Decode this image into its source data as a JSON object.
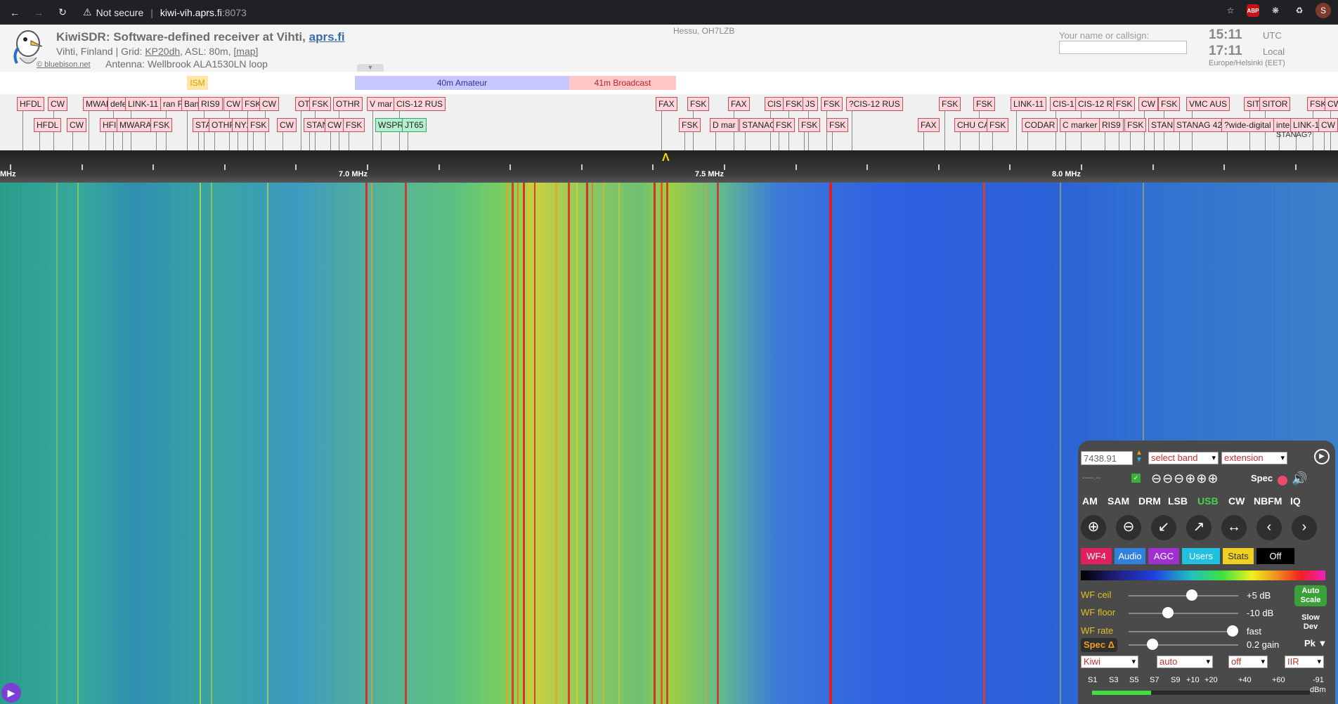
{
  "browser": {
    "security_text": "Not secure",
    "host": "kiwi-vih.aprs.fi",
    "port": ":8073",
    "avatar_letter": "S",
    "abp_label": "ABP"
  },
  "header": {
    "title_prefix": "KiwiSDR: Software-defined receiver at Vihti,",
    "title_link": "aprs.fi",
    "location_prefix": "Vihti, Finland | Grid:",
    "grid": "KP20dh",
    "asl": ", ASL: 80m,",
    "map_link": "[map]",
    "logo_credit": "© bluebison.net",
    "antenna": "Antenna: Wellbrook ALA1530LN loop",
    "operator": "Hessu, OH7LZB",
    "name_label": "Your name or callsign:",
    "name_value": "",
    "utc_time": "15:11",
    "utc_label": "UTC",
    "local_time": "17:11",
    "local_label": "Local",
    "timezone": "Europe/Helsinki (EET)"
  },
  "bands": [
    {
      "label": "ISM",
      "color": "#ffe6a8",
      "text_color": "#e0a000"
    },
    {
      "label": "40m Amateur",
      "color": "#c8c8ff",
      "text_color": "#3030a0"
    },
    {
      "label": "41m Broadcast",
      "color": "#ffc8c8",
      "text_color": "#c02020"
    }
  ],
  "dx_labels": {
    "row1": [
      "HFDL",
      "CW",
      "MWAR",
      "defe",
      "LINK-11",
      "ran F",
      "Ban",
      "RIS9",
      "CW",
      "FSK",
      "CW",
      "OTI",
      "FSK",
      "OTHR",
      "V mar",
      "CIS-12 RUS",
      "FAX",
      "FSK",
      "FAX",
      "CIS",
      "FSK",
      "JS",
      "FSK",
      "?CIS-12 RUS",
      "FSK",
      "FSK",
      "LINK-11",
      "CIS-1",
      "CIS-12 R",
      "FSK",
      "CW",
      "FSK",
      "VMC AUS",
      "SIT",
      "SITOR",
      "FSK",
      "CW"
    ],
    "row2": [
      "HFDL",
      "CW",
      "HFI",
      "MWARA",
      "FSK",
      "STA",
      "OTHR",
      "NY2",
      "FSK",
      "CW",
      "STAN",
      "CW",
      "FSK",
      "WSPR",
      "JT65",
      "FSK",
      "D mar",
      "STANAG",
      "FSK",
      "FSK",
      "FSK",
      "FAX",
      "CHU CA",
      "FSK",
      "CODAR",
      "C marker",
      "RIS9",
      "FSK",
      "STAN",
      "STANAG 42",
      "?wide-digital",
      "inte",
      "LINK-1",
      "CW"
    ],
    "row3_extra": "STANAG?"
  },
  "scale": {
    "labels": [
      "MHz",
      "7.0 MHz",
      "7.5 MHz",
      "8.0 MHz"
    ]
  },
  "panel": {
    "frequency": "7438.91",
    "band_select": "select band",
    "extension_select": "extension",
    "small_readout": "-----.--",
    "spec_label": "Spec",
    "modes": [
      "AM",
      "SAM",
      "DRM",
      "LSB",
      "USB",
      "CW",
      "NBFM",
      "IQ"
    ],
    "active_mode": "USB",
    "tabs": [
      {
        "label": "WF4",
        "color": "#e02060"
      },
      {
        "label": "Audio",
        "color": "#3080e0"
      },
      {
        "label": "AGC",
        "color": "#a030d0"
      },
      {
        "label": "Users",
        "color": "#20c0e0"
      },
      {
        "label": "Stats",
        "color": "#f0d020",
        "text_color": "#333"
      },
      {
        "label": "Off",
        "color": "#000"
      }
    ],
    "sliders": [
      {
        "label": "WF ceil",
        "value": "+5 dB",
        "level": 0.58
      },
      {
        "label": "WF floor",
        "value": "-10 dB",
        "level": 0.36
      },
      {
        "label": "WF rate",
        "value": "fast",
        "level": 0.95
      }
    ],
    "spec_delta": "Spec Δ",
    "spec_delta_value": "0.2 gain",
    "spec_delta_level": 0.22,
    "pk_label": "Pk",
    "auto_scale": "Auto Scale",
    "slow_dev": "Slow Dev",
    "dropdowns": [
      "Kiwi",
      "auto",
      "off",
      "IIR"
    ],
    "smeter_labels": [
      "S1",
      "S3",
      "S5",
      "S7",
      "S9",
      "+10",
      "+20",
      "+40",
      "+60",
      "-91"
    ],
    "smeter_unit": "dBm",
    "smeter_fill": 0.27
  }
}
